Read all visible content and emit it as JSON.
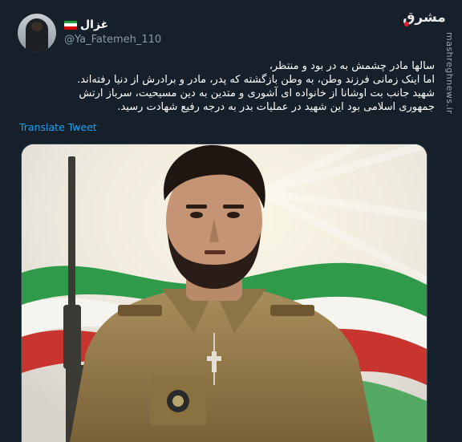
{
  "tweet": {
    "display_name": "غزال",
    "handle": "@Ya_Fatemeh_110",
    "text_lines": [
      "سالها مادر چشمش به در بود و منتظر،",
      "اما اینک زمانی فرزند وطن، به وطن بازگشته که پدر، مادر و برادرش از دنیا رفته‌اند.",
      "شهید جانب بت اوشانا از خانواده ای آشوری و متدین به دین مسیحیت، سرباز ارتش",
      "جمهوری اسلامی بود این شهید در عملیات بدر به درجه رفیع شهادت رسید."
    ],
    "translate_label": "Translate Tweet"
  },
  "source": {
    "logo_text": "مشرق",
    "watermark": "mashreghnews.ir"
  },
  "icons": {
    "flag": "iran-flag-icon",
    "avatar": "profile-avatar"
  },
  "colors": {
    "background": "#15202b",
    "secondary_text": "#8899a6",
    "link": "#1da1f2"
  }
}
